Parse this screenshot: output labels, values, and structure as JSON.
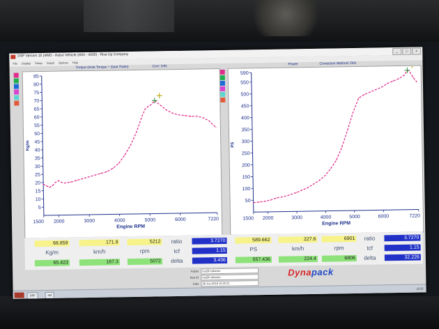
{
  "window": {
    "title": "DSF Version 15 (4WD - Hubs/ Vehicle 2000 - 4000) - Rise Up Company",
    "menu": [
      "File",
      "Display",
      "Setup",
      "Graph",
      "Options",
      "Help"
    ]
  },
  "left_graph": {
    "header": "Torque (Axle Torque ÷ Gear Ratio)",
    "correction": "Corr: DIN",
    "ylabel": "Kg/m",
    "legend_colors": [
      "#e02d8c",
      "#20b050",
      "#1e6bd8",
      "#d944d2",
      "#5ed6d0",
      "#e25a3a"
    ]
  },
  "right_graph": {
    "header": "Power",
    "correction": "Correction Method: DIN",
    "ylabel": "PS",
    "legend_colors": [
      "#e02d8c",
      "#20b050",
      "#1e6bd8",
      "#d944d2",
      "#5ed6d0",
      "#e25a3a"
    ]
  },
  "chart_data": [
    {
      "type": "line",
      "title": "Torque (Axle Torque ÷ Gear Ratio)",
      "xlabel": "Engine RPM",
      "ylabel": "Kg/m",
      "xlim": [
        1500,
        7220
      ],
      "ylim": [
        0,
        85
      ],
      "x_ticks": [
        "1500",
        "2000",
        "3000",
        "4000",
        "5000",
        "6000",
        "7220"
      ],
      "y_ticks": [
        "5",
        "10",
        "15",
        "20",
        "25",
        "30",
        "35",
        "40",
        "45",
        "50",
        "55",
        "60",
        "65",
        "70",
        "75",
        "80",
        "85"
      ],
      "grid": false,
      "series": [
        {
          "color": "#e02d8c",
          "style": "dashed",
          "x": [
            1500,
            1600,
            1700,
            1800,
            1900,
            2000,
            2100,
            2200,
            2400,
            2600,
            2800,
            3000,
            3200,
            3400,
            3600,
            3800,
            4000,
            4200,
            4400,
            4600,
            4800,
            4900,
            5000,
            5100,
            5212,
            5400,
            5600,
            5800,
            6000,
            6200,
            6400,
            6600,
            6800,
            7000,
            7100,
            7220
          ],
          "y": [
            19,
            18,
            17,
            18,
            20,
            21,
            20,
            19.5,
            20,
            21,
            22,
            23,
            24,
            25,
            26,
            28,
            31,
            36,
            42,
            50,
            60,
            64,
            65.5,
            66.5,
            68.9,
            66,
            63,
            61,
            60,
            59.5,
            59,
            59,
            58,
            56,
            54,
            52
          ]
        }
      ],
      "markers": [
        {
          "x": 5212,
          "y": 68.9
        }
      ]
    },
    {
      "type": "line",
      "title": "Power",
      "xlabel": "Engine RPM",
      "ylabel": "PS",
      "xlim": [
        1500,
        7220
      ],
      "ylim": [
        0,
        590
      ],
      "x_ticks": [
        "1500",
        "2000",
        "3000",
        "4000",
        "5000",
        "6000",
        "7220"
      ],
      "y_ticks": [
        "50",
        "100",
        "150",
        "200",
        "250",
        "300",
        "350",
        "400",
        "450",
        "500",
        "550",
        "590"
      ],
      "grid": false,
      "series": [
        {
          "color": "#e02d8c",
          "style": "dashed",
          "x": [
            1500,
            1700,
            1900,
            2100,
            2300,
            2500,
            2700,
            3000,
            3200,
            3400,
            3600,
            3800,
            4000,
            4200,
            4400,
            4600,
            4800,
            5000,
            5200,
            5400,
            5600,
            5800,
            6000,
            6200,
            6400,
            6600,
            6800,
            6901,
            7000,
            7100,
            7220
          ],
          "y": [
            40,
            42,
            45,
            50,
            58,
            62,
            68,
            80,
            90,
            100,
            115,
            130,
            150,
            180,
            215,
            270,
            340,
            415,
            475,
            490,
            500,
            510,
            520,
            535,
            545,
            555,
            570,
            590,
            580,
            560,
            540
          ]
        }
      ],
      "markers": [
        {
          "x": 6901,
          "y": 590
        }
      ]
    }
  ],
  "readouts": {
    "left": {
      "top": [
        "68.859",
        "171.9",
        "5212"
      ],
      "units": [
        "Kg/m",
        "km/h",
        "rpm"
      ],
      "bottom": [
        "65.423",
        "167.3",
        "5072"
      ],
      "ratio_label": "ratio",
      "ratio_value": "3.7270",
      "tcf_label": "tcf",
      "tcf_value": "1.15",
      "delta_label": "delta",
      "delta_value": "3.436"
    },
    "right": {
      "top": [
        "589.662",
        "227.6",
        "6901"
      ],
      "units": [
        "PS",
        "km/h",
        "rpm"
      ],
      "bottom": [
        "557.436",
        "224.4",
        "6806"
      ],
      "ratio_label": "ratio",
      "ratio_value": "3.7270",
      "tcf_label": "tcf",
      "tcf_value": "1.15",
      "delta_label": "delta",
      "delta_value": "32.226"
    }
  },
  "file_info": {
    "folder_label": "Folder",
    "folder_value": "rsa28 rothecks",
    "runid_label": "Run ID",
    "runid_value": "rsa28 rothecks",
    "date_label": "Date",
    "date_value": "26-Jun-2018 15:22:21"
  },
  "logo": {
    "part1": "Dyna",
    "part2": "pack",
    "color1": "#d7262a",
    "color2": "#1f47c6"
  },
  "taskbar": {
    "task1": "DSF",
    "task2": "dsf",
    "clock": "15:22"
  }
}
